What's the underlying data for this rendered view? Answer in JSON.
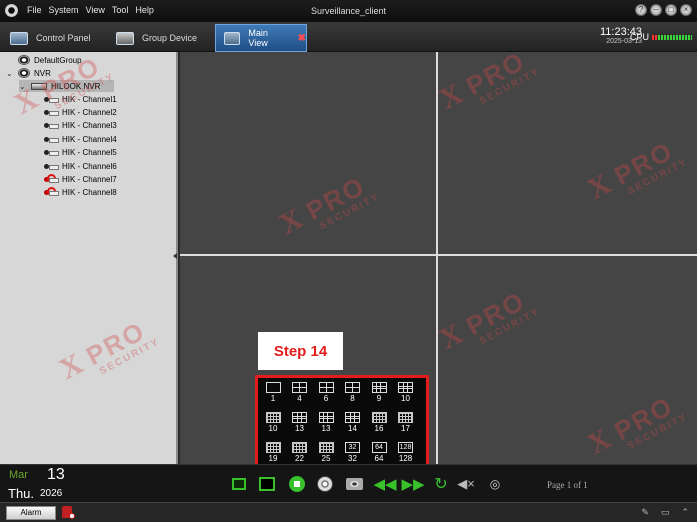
{
  "titlebar": {
    "menu": [
      "File",
      "System",
      "View",
      "Tool",
      "Help"
    ],
    "title": "Surveillance_client",
    "buttons": [
      "help-icon",
      "minimize-icon",
      "maximize-icon",
      "close-icon"
    ]
  },
  "tabs": [
    {
      "label": "Control Panel",
      "icon": "control-panel-icon"
    },
    {
      "label": "Group Device",
      "icon": "group-device-icon"
    },
    {
      "label": "Main View",
      "icon": "main-view-icon",
      "active": true,
      "closable": "✖"
    }
  ],
  "clock": {
    "time": "11:23:43",
    "date": "2025-03-13"
  },
  "cpu": {
    "label": "CPU"
  },
  "tree": {
    "default_group": "DefaultGroup",
    "nvr": "NVR",
    "nvr_device": "HILOOK NVR",
    "channels": [
      {
        "label": "HIK - Channel1",
        "online": true
      },
      {
        "label": "HIK - Channel2",
        "online": true
      },
      {
        "label": "HIK - Channel3",
        "online": true
      },
      {
        "label": "HIK - Channel4",
        "online": true
      },
      {
        "label": "HIK - Channel5",
        "online": true
      },
      {
        "label": "HIK - Channel6",
        "online": true
      },
      {
        "label": "HIK - Channel7",
        "online": false
      },
      {
        "label": "HIK - Channel8",
        "online": false
      }
    ]
  },
  "step_label": "Step 14",
  "layouts": [
    {
      "num": "1",
      "icon": "single"
    },
    {
      "num": "4",
      "icon": "g4"
    },
    {
      "num": "6",
      "icon": "g4"
    },
    {
      "num": "8",
      "icon": "g4"
    },
    {
      "num": "9",
      "icon": "g9"
    },
    {
      "num": "10",
      "icon": "g9"
    },
    {
      "num": "10",
      "icon": "gm"
    },
    {
      "num": "13",
      "icon": "g9"
    },
    {
      "num": "13",
      "icon": "g9"
    },
    {
      "num": "14",
      "icon": "g9"
    },
    {
      "num": "16",
      "icon": "gm"
    },
    {
      "num": "17",
      "icon": "gm"
    },
    {
      "num": "19",
      "icon": "gm"
    },
    {
      "num": "22",
      "icon": "gm"
    },
    {
      "num": "25",
      "icon": "gm"
    },
    {
      "num": "32",
      "icon": "txt",
      "box_text": "32"
    },
    {
      "num": "64",
      "icon": "txt",
      "box_text": "64"
    },
    {
      "num": "128",
      "icon": "txt",
      "box_text": "128"
    }
  ],
  "bottom": {
    "month": "Mar",
    "day": "13",
    "weekday": "Thu.",
    "year": "2026",
    "page_text": "Page 1 of 1",
    "controls": [
      "fullscreen-icon",
      "layout-icon",
      "stop-all-icon",
      "record-icon",
      "snapshot-icon",
      "previous-page-icon",
      "next-page-icon",
      "cycle-icon",
      "mute-icon",
      "settings-icon"
    ]
  },
  "status": {
    "alarm_label": "Alarm"
  },
  "watermark": {
    "brand": "PRO",
    "sub": "SECURITY"
  },
  "colors": {
    "accent": "#e41c1c",
    "tab_active": "#2f64a0",
    "video_bg": "#454545",
    "sidebar_bg": "#d7d7d7"
  }
}
